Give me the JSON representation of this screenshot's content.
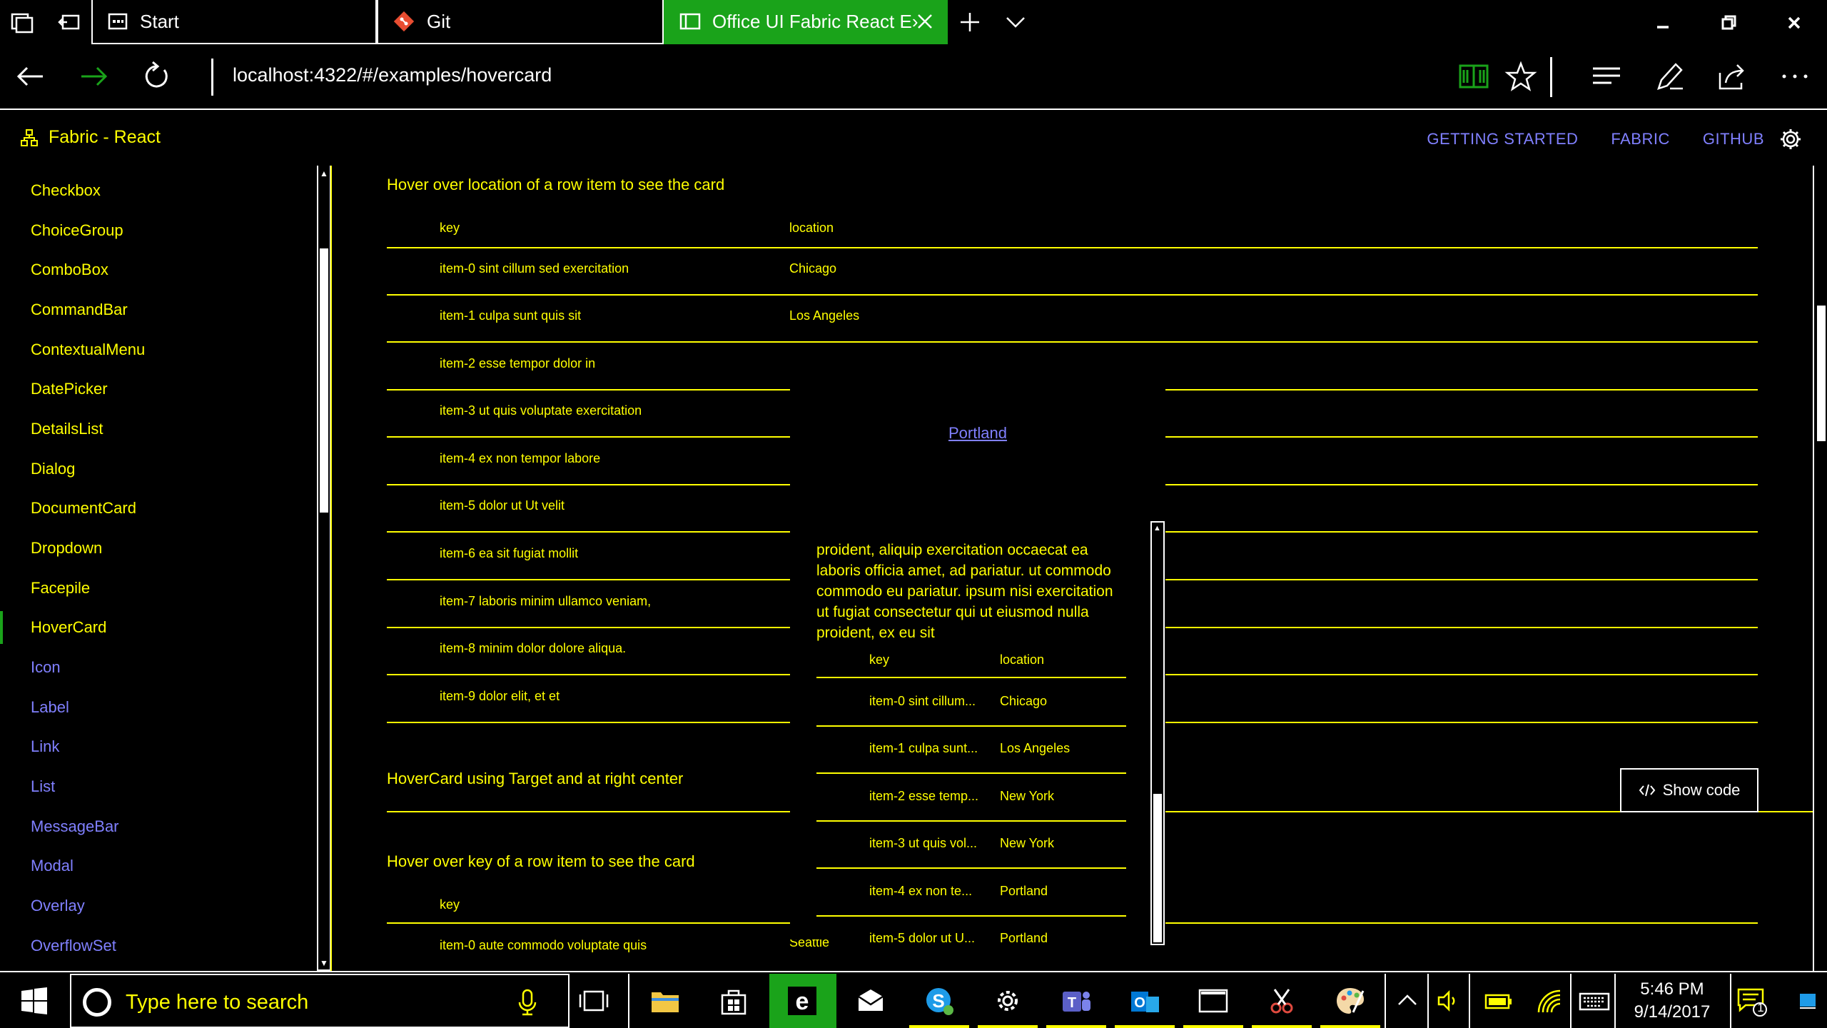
{
  "browser": {
    "tabs": [
      {
        "label": "Start"
      },
      {
        "label": "Git"
      },
      {
        "label": "Office UI Fabric React E›"
      }
    ],
    "url": "localhost:4322/#/examples/hovercard"
  },
  "header": {
    "brand": "Fabric - React",
    "links": [
      "GETTING STARTED",
      "FABRIC",
      "GITHUB"
    ]
  },
  "sidebar": {
    "active": "HoverCard",
    "items": [
      {
        "label": "Checkbox"
      },
      {
        "label": "ChoiceGroup"
      },
      {
        "label": "ComboBox"
      },
      {
        "label": "CommandBar"
      },
      {
        "label": "ContextualMenu"
      },
      {
        "label": "DatePicker"
      },
      {
        "label": "DetailsList"
      },
      {
        "label": "Dialog"
      },
      {
        "label": "DocumentCard"
      },
      {
        "label": "Dropdown"
      },
      {
        "label": "Facepile"
      },
      {
        "label": "HoverCard"
      },
      {
        "label": "Icon"
      },
      {
        "label": "Label"
      },
      {
        "label": "Link"
      },
      {
        "label": "List"
      },
      {
        "label": "MessageBar"
      },
      {
        "label": "Modal"
      },
      {
        "label": "Overlay"
      },
      {
        "label": "OverflowSet"
      }
    ]
  },
  "main": {
    "section1": {
      "title": "Hover over location of a row item to see the card",
      "columns": [
        "key",
        "location"
      ],
      "rows": [
        {
          "key": "item-0 sint cillum sed exercitation",
          "location": "Chicago"
        },
        {
          "key": "item-1 culpa sunt quis sit",
          "location": "Los Angeles"
        },
        {
          "key": "item-2 esse tempor dolor in",
          "location": ""
        },
        {
          "key": "item-3 ut quis voluptate exercitation",
          "location": ""
        },
        {
          "key": "item-4 ex non tempor labore",
          "location": ""
        },
        {
          "key": "item-5 dolor ut Ut velit",
          "location": ""
        },
        {
          "key": "item-6 ea sit fugiat mollit",
          "location": ""
        },
        {
          "key": "item-7 laboris minim ullamco veniam,",
          "location": ""
        },
        {
          "key": "item-8 minim dolor dolore aliqua.",
          "location": ""
        },
        {
          "key": "item-9 dolor elit, et et",
          "location": ""
        }
      ]
    },
    "section2": {
      "title": "HoverCard using Target and at right center"
    },
    "section3": {
      "title": "Hover over key of a row item to see the card",
      "columns": [
        "key"
      ],
      "rows": [
        {
          "key": "item-0 aute commodo voluptate quis",
          "location": "Seattle"
        }
      ]
    },
    "hovercard": {
      "link": "Portland",
      "text": "proident, aliquip exercitation occaecat ea laboris officia amet, ad pariatur. ut commodo commodo eu pariatur. ipsum nisi exercitation ut fugiat consectetur qui ut eiusmod nulla proident, ex eu sit",
      "columns": [
        "key",
        "location"
      ],
      "rows": [
        {
          "key": "item-0 sint cillum...",
          "location": "Chicago"
        },
        {
          "key": "item-1 culpa sunt...",
          "location": "Los Angeles"
        },
        {
          "key": "item-2 esse temp...",
          "location": "New York"
        },
        {
          "key": "item-3 ut quis vol...",
          "location": "New York"
        },
        {
          "key": "item-4 ex non te...",
          "location": "Portland"
        },
        {
          "key": "item-5 dolor ut U...",
          "location": "Portland"
        }
      ]
    },
    "show_code_label": "Show code"
  },
  "taskbar": {
    "search_placeholder": "Type here to search",
    "time": "5:46 PM",
    "date": "9/14/2017",
    "notification_count": "1"
  },
  "colors": {
    "text": "#ffff00",
    "link": "#8080ff",
    "accent": "#1aa31a",
    "background": "#000000"
  }
}
